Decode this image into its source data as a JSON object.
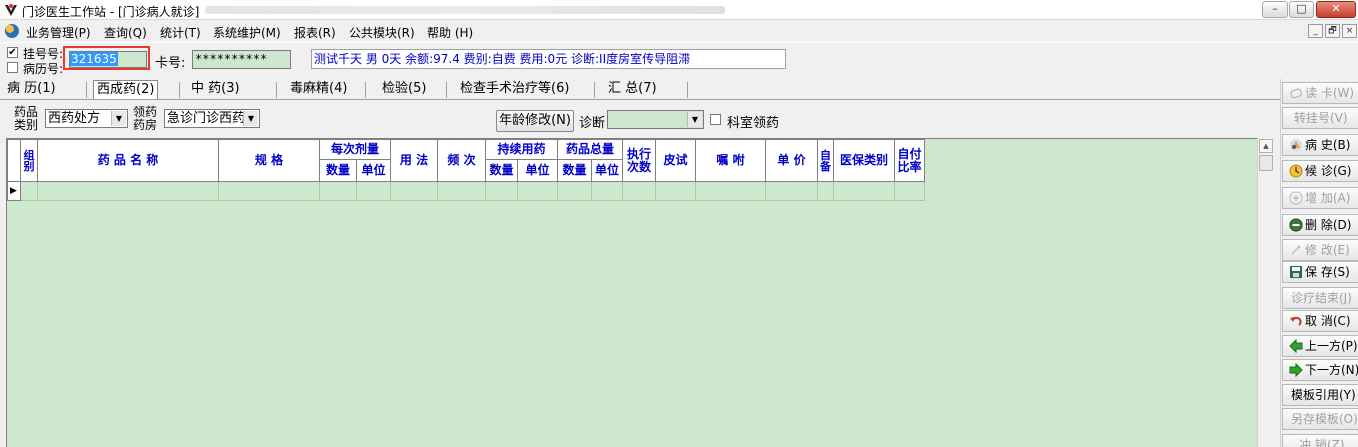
{
  "window": {
    "title": "门诊医生工作站 - [门诊病人就诊]",
    "min": "–",
    "max": "□",
    "close": "✕"
  },
  "menu": {
    "items": [
      "业务管理(P)",
      "查询(Q)",
      "统计(T)",
      "系统维护(M)",
      "报表(R)",
      "公共模块(R)",
      "帮助 (H)"
    ],
    "mdi": [
      "_",
      "🗗",
      "×"
    ]
  },
  "info": {
    "registration_label": "挂号号:",
    "registration_checked": "✔",
    "registration_value": "321635",
    "record_label": "病历号:",
    "card_label": "卡号:",
    "card_value": "**********",
    "patient_info": "测试千天 男 0天 余额:97.4 费别:自费 费用:0元 诊断:II度房室传导阻滞"
  },
  "tabs": [
    "病  历(1)",
    "西成药(2)",
    "中  药(3)",
    "毒麻精(4)",
    "检验(5)",
    "检查手术治疗等(6)",
    "汇  总(7)"
  ],
  "active_tab_index": 1,
  "filters": {
    "drug_category_label": [
      "药品",
      "类别"
    ],
    "drug_category_value": "西药处方",
    "pharmacy_label": [
      "领药",
      "药房"
    ],
    "pharmacy_value": "急诊门诊西药",
    "age_modify_button": "年龄修改(N)",
    "diagnosis_label": "诊断",
    "diagnosis_value": "",
    "dept_pickup_label": "科室领药"
  },
  "grid": {
    "headers": {
      "group": "组别",
      "drug_name": "药 品 名 称",
      "spec": "规     格",
      "per_dose": "每次剂量",
      "usage": "用 法",
      "frequency": "频  次",
      "continuous": "持续用药",
      "total": "药品总量",
      "exec_times": "执行次数",
      "skin_test": "皮试",
      "advice": "嘱   咐",
      "unit_price": "单 价",
      "self_provided": "自备",
      "insurance_type": "医保类别",
      "self_pay_ratio": "自付比率",
      "qty": "数量",
      "unit": "单位"
    },
    "row_indicator": "▶"
  },
  "sidebar": [
    {
      "label": "读 卡(W)",
      "icon": "card-icon",
      "disabled": true
    },
    {
      "label": "转挂号(V)",
      "icon": "",
      "disabled": true
    },
    {
      "label": "病  史(B)",
      "icon": "history-icon",
      "disabled": false
    },
    {
      "label": "候  诊(G)",
      "icon": "clock-icon",
      "disabled": false
    },
    {
      "label": "增  加(A)",
      "icon": "plus-icon",
      "disabled": true
    },
    {
      "label": "删  除(D)",
      "icon": "minus-icon",
      "disabled": false
    },
    {
      "label": "修  改(E)",
      "icon": "edit-icon",
      "disabled": true
    },
    {
      "label": "保  存(S)",
      "icon": "save-icon",
      "disabled": false
    },
    {
      "label": "诊疗结束(J)",
      "icon": "",
      "disabled": true
    },
    {
      "label": "取  消(C)",
      "icon": "undo-icon",
      "disabled": false
    },
    {
      "label": "上一方(P)",
      "icon": "arrow-left-icon",
      "disabled": false
    },
    {
      "label": "下一方(N)",
      "icon": "arrow-right-icon",
      "disabled": false
    },
    {
      "label": "模板引用(Y)",
      "icon": "",
      "disabled": false
    },
    {
      "label": "另存模板(O)",
      "icon": "",
      "disabled": true
    },
    {
      "label": "冲 销(Z)",
      "icon": "",
      "disabled": true
    }
  ]
}
